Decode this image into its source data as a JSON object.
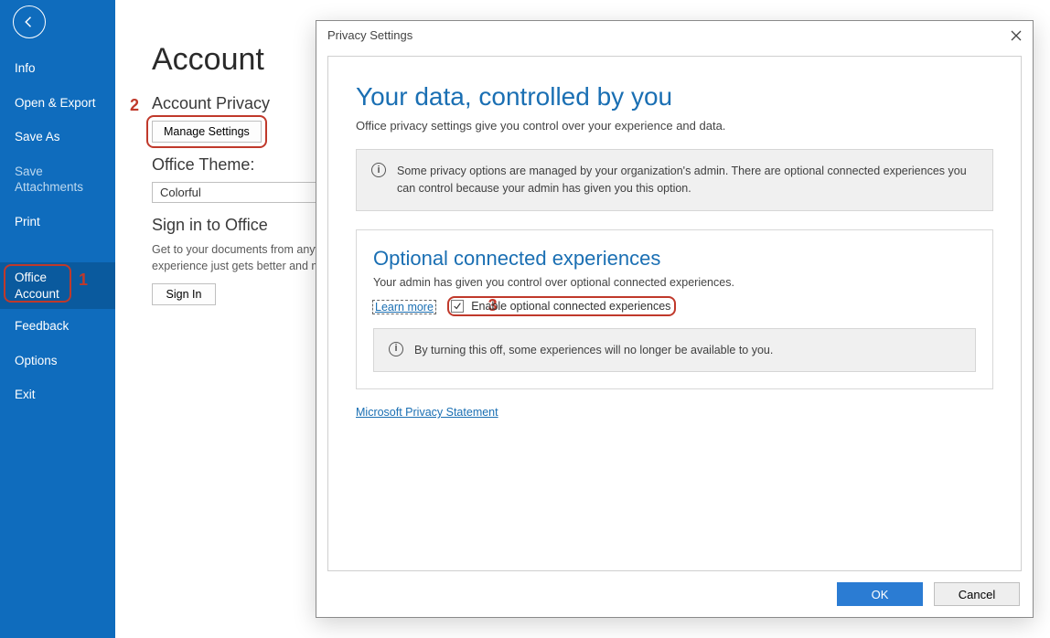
{
  "sidebar": {
    "items": [
      {
        "label": "Info"
      },
      {
        "label": "Open & Export"
      },
      {
        "label": "Save As"
      },
      {
        "label": "Save Attachments"
      },
      {
        "label": "Print"
      },
      {
        "label": "Office Account"
      },
      {
        "label": "Feedback"
      },
      {
        "label": "Options"
      },
      {
        "label": "Exit"
      }
    ]
  },
  "annot": {
    "num1": "1",
    "num2": "2",
    "num3": "3"
  },
  "main": {
    "title": "Account",
    "privacy_head": "Account Privacy",
    "manage_settings": "Manage Settings",
    "theme_head": "Office Theme:",
    "theme_value": "Colorful",
    "signin_head": "Sign in to Office",
    "signin_desc": "Get to your documents from anywhere by signing in to Office. Your experience just gets better and more personalized on every device you use.",
    "signin_btn": "Sign In"
  },
  "dialog": {
    "title": "Privacy Settings",
    "h1": "Your data, controlled by you",
    "p1": "Office privacy settings give you control over your experience and data.",
    "admin_note": "Some privacy options are managed by your organization's admin. There are optional connected experiences you can control because your admin has given you this option.",
    "section_h": "Optional connected experiences",
    "section_p": "Your admin has given you control over optional connected experiences.",
    "learn_more": "Learn more",
    "chk_label": "Enable optional connected experiences",
    "turn_off_note": "By turning this off, some experiences will no longer be available to you.",
    "privacy_link": "Microsoft Privacy Statement",
    "ok": "OK",
    "cancel": "Cancel"
  }
}
